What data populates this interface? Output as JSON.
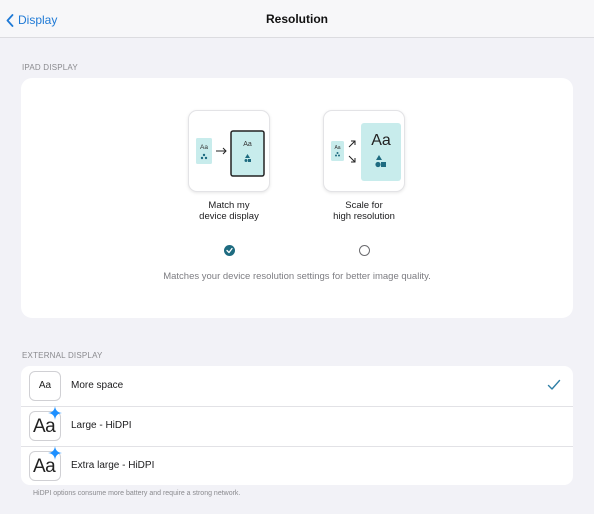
{
  "navbar": {
    "back_label": "Display",
    "title": "Resolution"
  },
  "ipad_display": {
    "section_label": "IPAD DISPLAY",
    "options": [
      {
        "label_line1": "Match my",
        "label_line2": "device display",
        "tile_text_left": "Aa",
        "tile_text_right": "Aa",
        "selected": true
      },
      {
        "label_line1": "Scale for",
        "label_line2": "high resolution",
        "tile_text_left": "Aa",
        "tile_text_right": "Aa",
        "selected": false
      }
    ],
    "description": "Matches your device resolution settings for better image quality."
  },
  "external_display": {
    "section_label": "EXTERNAL DISPLAY",
    "items": [
      {
        "icon_text": "Aa",
        "label": "More space",
        "selected": true,
        "icon": "text-size-icon"
      },
      {
        "icon_text": "Aa",
        "label": "Large - HiDPI",
        "selected": false,
        "icon": "text-size-sparkle-icon"
      },
      {
        "icon_text": "Aa",
        "label": "Extra large - HiDPI",
        "selected": false,
        "icon": "text-size-sparkle-icon"
      }
    ],
    "footnote": "HiDPI options consume more battery and require a strong network."
  },
  "colors": {
    "accent": "#1f7ad6",
    "selected_radio": "#1e6b80",
    "checkmark": "#2f7fa6",
    "sparkle": "#1e90ff",
    "tile_fill": "#c8ecec",
    "background": "#f2f2f7"
  }
}
